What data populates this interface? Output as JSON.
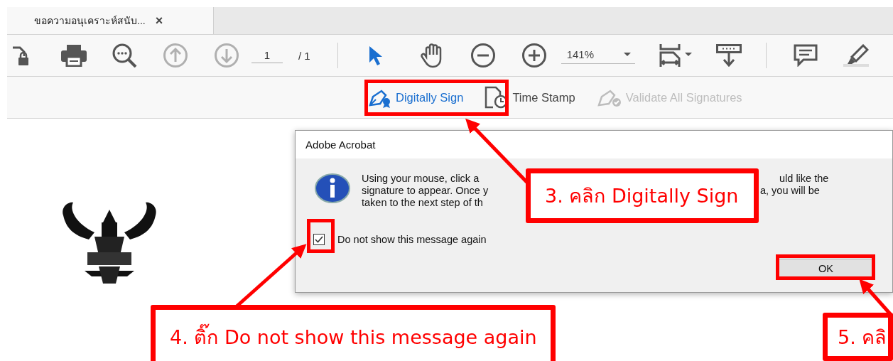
{
  "tabs": [
    {
      "label": "ขอความอนุเคราะห์สนับ...",
      "close": "×",
      "selected": true
    }
  ],
  "toolbar": {
    "page_buttons_disabled": true,
    "select_tool_selected": true,
    "page_current": "1",
    "page_total": "/ 1",
    "zoom": "141%"
  },
  "sign_bar": [
    {
      "kind": "sign",
      "label": "Digitally Sign",
      "disabled": false
    },
    {
      "kind": "timestamp",
      "label": "Time Stamp",
      "disabled": false
    },
    {
      "kind": "validate",
      "label": "Validate All Signatures",
      "disabled": true
    }
  ],
  "dialog": {
    "title": "Adobe Acrobat",
    "message_lines": [
      {
        "left": "Using your mouse, click a",
        "right": "uld like the"
      },
      {
        "left": "signature to appear. Once y",
        "right": "a, you will be"
      },
      {
        "left": "taken to the next step of th"
      }
    ],
    "checkbox": {
      "label": "Do not show this message again",
      "checked": true
    },
    "button": "OK"
  },
  "callouts": [
    {
      "text": "3. คลิก Digitally Sign"
    },
    {
      "text": "4. ติ๊ก Do not show this message again"
    },
    {
      "text": "5. คลิ"
    }
  ]
}
